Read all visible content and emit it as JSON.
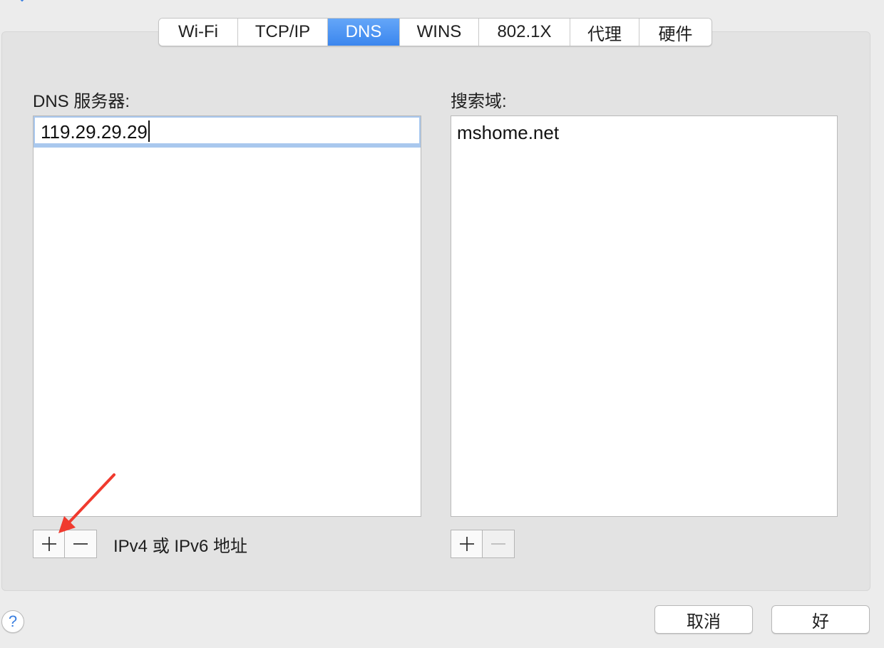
{
  "tabs": [
    {
      "label": "Wi-Fi",
      "active": false
    },
    {
      "label": "TCP/IP",
      "active": false
    },
    {
      "label": "DNS",
      "active": true
    },
    {
      "label": "WINS",
      "active": false
    },
    {
      "label": "802.1X",
      "active": false
    },
    {
      "label": "代理",
      "active": false
    },
    {
      "label": "硬件",
      "active": false
    }
  ],
  "dns_servers": {
    "label": "DNS 服务器:",
    "entries": [
      "119.29.29.29"
    ],
    "hint": "IPv4 或 IPv6 地址",
    "add_icon": "plus-icon",
    "remove_icon": "minus-icon"
  },
  "search_domains": {
    "label": "搜索域:",
    "entries": [
      "mshome.net"
    ],
    "add_icon": "plus-icon",
    "remove_icon": "minus-icon",
    "remove_disabled": true
  },
  "footer": {
    "help_label": "?",
    "cancel_label": "取消",
    "ok_label": "好"
  },
  "annotation": {
    "arrow_color": "#f03a2e"
  },
  "colors": {
    "active_tab": "#3d8cf2",
    "selection_border": "#a9c8ee",
    "help_icon": "#3a7fe0"
  }
}
